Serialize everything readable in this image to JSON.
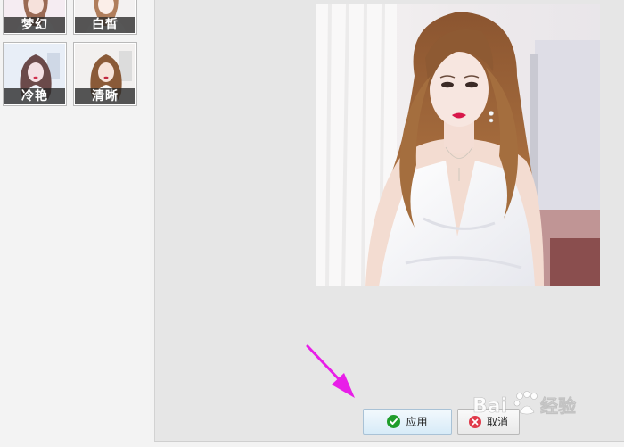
{
  "filters": [
    {
      "label": "梦幻"
    },
    {
      "label": "白皙"
    },
    {
      "label": "冷艳"
    },
    {
      "label": "清晰"
    }
  ],
  "buttons": {
    "apply_label": "应用",
    "cancel_label": "取消"
  },
  "watermark": {
    "brand": "Baidu",
    "product": "经验"
  },
  "colors": {
    "arrow": "#e81ee8",
    "apply_icon": "#1f9d2b",
    "cancel_icon": "#e03a4a"
  }
}
